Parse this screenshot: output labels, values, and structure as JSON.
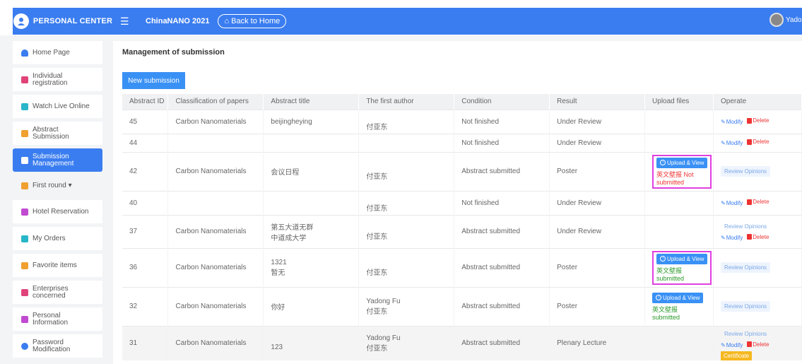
{
  "header": {
    "brand": "PERSONAL CENTER",
    "menu_icon": "hamburger-icon",
    "conference": "ChinaNANO 2021",
    "back_home": "Back to Home",
    "username": "Yado"
  },
  "sidebar": {
    "items": [
      {
        "label": "Home Page",
        "icon": "home-icon",
        "color": "#3a7df0"
      },
      {
        "label": "Individual\nregistration",
        "icon": "id-card-icon",
        "color": "#e0437a"
      },
      {
        "label": "Watch Live Online",
        "icon": "video-icon",
        "color": "#29b6c9"
      },
      {
        "label": "Abstract\nSubmission",
        "icon": "edit-icon",
        "color": "#f0a030"
      },
      {
        "label": "Submission\nManagement",
        "icon": "document-icon",
        "color": "#ffffff"
      },
      {
        "label": "First round ▾",
        "icon": "user-icon",
        "color": "#f0a030"
      },
      {
        "label": "Hotel Reservation",
        "icon": "hotel-icon",
        "color": "#c04ad0"
      },
      {
        "label": "My Orders",
        "icon": "bag-icon",
        "color": "#29b6c9"
      },
      {
        "label": "Favorite items",
        "icon": "star-icon",
        "color": "#f0a030"
      },
      {
        "label": "Enterprises\nconcerned",
        "icon": "briefcase-icon",
        "color": "#e0437a"
      },
      {
        "label": "Personal\nInformation",
        "icon": "profile-icon",
        "color": "#c04ad0"
      },
      {
        "label": "Password\nModification",
        "icon": "key-icon",
        "color": "#3a7df0"
      }
    ]
  },
  "main": {
    "title": "Management of submission",
    "new_button": "New submission",
    "columns": [
      "Abstract ID",
      "Classification of papers",
      "Abstract title",
      "The first author",
      "Condition",
      "Result",
      "Upload files",
      "Operate"
    ],
    "rows": [
      {
        "id": "45",
        "classification": "Carbon Nanomaterials",
        "title": "beijingheying",
        "author": "付亚东",
        "condition": "Not finished",
        "result": "Under Review",
        "upload": "",
        "upload_status": "",
        "ops": "modify-delete"
      },
      {
        "id": "44",
        "classification": "",
        "title": "",
        "author": "",
        "condition": "Not finished",
        "result": "Under Review",
        "upload": "",
        "upload_status": "",
        "ops": "modify-delete"
      },
      {
        "id": "42",
        "classification": "Carbon Nanomaterials",
        "title": "会议日程",
        "author": "付亚东",
        "condition": "Abstract submitted",
        "result": "Poster",
        "upload": "Upload & View",
        "upload_status": "英文壁报 Not submitted",
        "ops": "review"
      },
      {
        "id": "40",
        "classification": "",
        "title": "",
        "author": "付亚东",
        "condition": "Not finished",
        "result": "Under Review",
        "upload": "",
        "upload_status": "",
        "ops": "modify-delete"
      },
      {
        "id": "37",
        "classification": "Carbon Nanomaterials",
        "title": "第五大道无群\n中道成大学",
        "author": "付亚东",
        "condition": "Abstract submitted",
        "result": "Under Review",
        "upload": "",
        "upload_status": "",
        "ops": "review-modify-delete"
      },
      {
        "id": "36",
        "classification": "Carbon Nanomaterials",
        "title": "1321\n暂无",
        "author": "付亚东",
        "condition": "Abstract submitted",
        "result": "Poster",
        "upload": "Upload & View",
        "upload_status": "英文壁报\nsubmitted",
        "ops": "review"
      },
      {
        "id": "32",
        "classification": "Carbon Nanomaterials",
        "title": "你好",
        "author": "Yadong Fu\n付亚东",
        "condition": "Abstract submitted",
        "result": "Poster",
        "upload": "Upload & View",
        "upload_status": "英文壁报\nsubmitted",
        "ops": "review"
      },
      {
        "id": "31",
        "classification": "Carbon Nanomaterials",
        "title": "123",
        "author": "Yadong Fu\n付亚东",
        "condition": "Abstract submitted",
        "result": "Plenary Lecture",
        "upload": "",
        "upload_status": "",
        "ops": "review-modify-delete-cert"
      }
    ],
    "labels": {
      "modify": "Modify",
      "delete": "Delete",
      "review": "Review Opinions",
      "certificate": "Certificate"
    }
  }
}
